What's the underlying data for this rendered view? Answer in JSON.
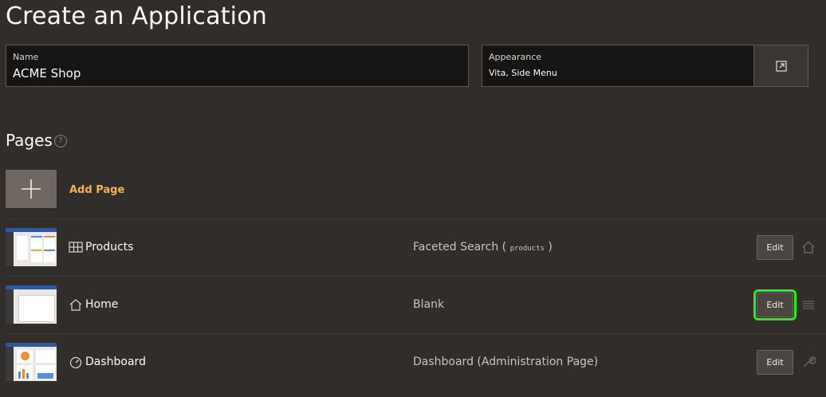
{
  "page": {
    "title": "Create an Application"
  },
  "fields": {
    "name": {
      "label": "Name",
      "value": "ACME Shop"
    },
    "appearance": {
      "label": "Appearance",
      "value": "Vita, Side Menu"
    }
  },
  "pages": {
    "heading": "Pages",
    "help": "?",
    "add_label": "Add Page",
    "rows": [
      {
        "name": "Products",
        "type": "Faceted Search (",
        "type_code": "products",
        "type_end": ")",
        "edit": "Edit",
        "icon": "grid-icon",
        "action_icon": "home-icon"
      },
      {
        "name": "Home",
        "type": "Blank",
        "edit": "Edit",
        "icon": "home-icon",
        "action_icon": "drag-handle-icon"
      },
      {
        "name": "Dashboard",
        "type": "Dashboard (Administration Page)",
        "edit": "Edit",
        "icon": "gauge-icon",
        "action_icon": "wrench-icon"
      }
    ]
  },
  "colors": {
    "background": "#312d2a",
    "accent": "#f0b35a",
    "highlight": "#22ee22"
  }
}
